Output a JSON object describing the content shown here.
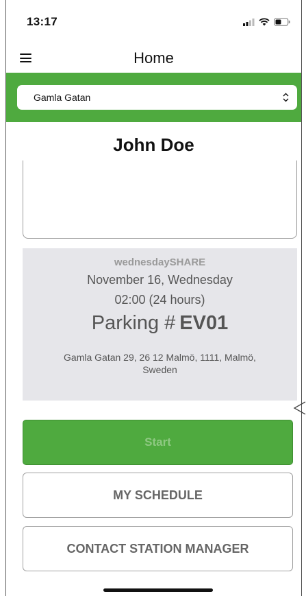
{
  "status": {
    "time": "13:17"
  },
  "nav": {
    "title": "Home"
  },
  "location": {
    "selected": "Gamla Gatan"
  },
  "user": {
    "name": "John Doe"
  },
  "booking": {
    "brand": "wednesdaySHARE",
    "date": "November 16, Wednesday",
    "time": "02:00 (24 hours)",
    "parking_prefix": "Parking #",
    "parking_code": "EV01",
    "address": "Gamla Gatan 29, 26 12 Malmö, 1111, Malmö, Sweden"
  },
  "actions": {
    "start": "Start",
    "my_schedule": "MY SCHEDULE",
    "contact": "CONTACT STATION MANAGER"
  },
  "icons": {
    "menu": "hamburger-menu-icon",
    "signal": "cellular-signal-icon",
    "wifi": "wifi-icon",
    "battery": "battery-icon",
    "select": "chevron-up-down-icon",
    "arrow": "left-chevron-icon"
  },
  "colors": {
    "accent_green": "#4faa3f",
    "card_gray": "#e6e6ea",
    "text_gray": "#555555"
  }
}
